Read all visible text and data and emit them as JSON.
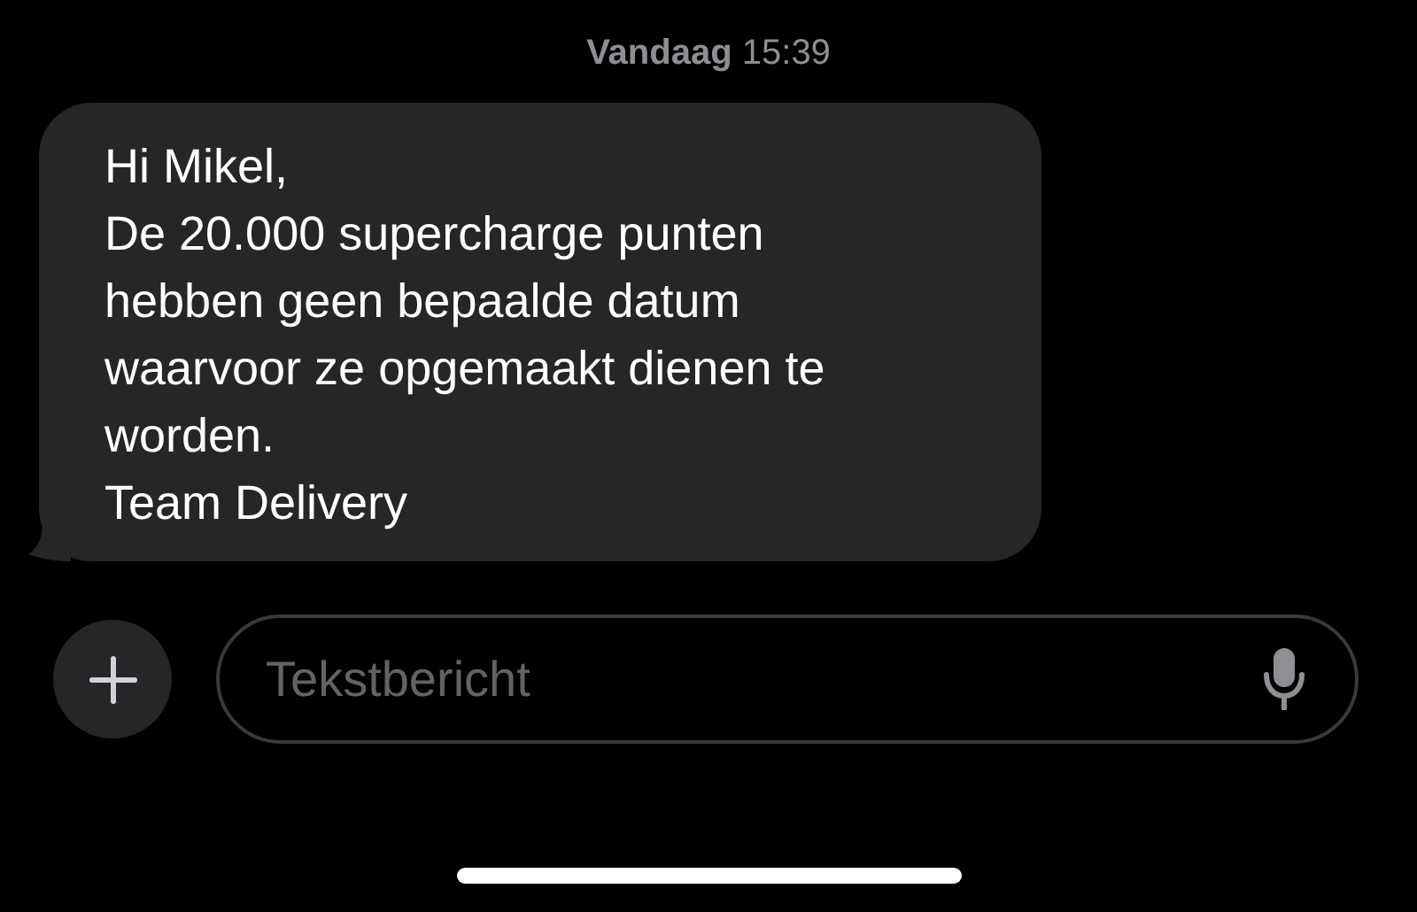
{
  "timestamp": "**Vandaag** 15:39",
  "message": {
    "incoming": true,
    "text": "Hi Mikel,\nDe 20.000 supercharge punten\nhebben geen bepaalde datum\nwaarvoor ze opgemaakt dienen te\nworden.\nTeam Delivery"
  },
  "composer": {
    "placeholder": "Tekstbericht"
  }
}
